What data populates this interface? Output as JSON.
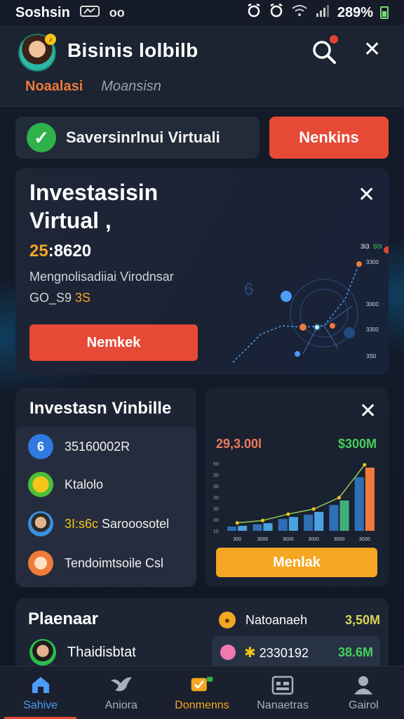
{
  "status_bar": {
    "carrier": "Soshsin",
    "extra": "oo",
    "battery_text": "289%"
  },
  "header": {
    "title": "Bisinis lolbilb",
    "tabs": [
      {
        "label": "Noaalasi",
        "active": true
      },
      {
        "label": "Moansisn",
        "active": false
      }
    ]
  },
  "notice": {
    "text": "Saversinrlnui Virtuali",
    "button_label": "Nenkins"
  },
  "card_virtual": {
    "title": "Investasisin Virtual ,",
    "amount_highlight": "25",
    "amount_rest": ":8620",
    "description": "Mengnolisadiiai Virodnsar",
    "sub_prefix": "GO_S9",
    "sub_highlight": "3S",
    "button_label": "Nemkek",
    "viz_labels": {
      "top_a": "3I3",
      "top_b": "50I",
      "ticks": [
        "3300",
        "3000",
        "3300",
        "3S0"
      ]
    }
  },
  "card_list": {
    "title": "Investasn Vinbille",
    "items": [
      {
        "icon": "6",
        "label": "35160002R",
        "highlight": ""
      },
      {
        "icon": "",
        "label": "Ktalolo",
        "highlight": ""
      },
      {
        "icon": "",
        "label": "Sarooosotel",
        "highlight": "3I:s6c"
      },
      {
        "icon": "",
        "label": "Tendoimtsoile Csl",
        "highlight": ""
      }
    ]
  },
  "card_chart": {
    "value_left": "29,3.00l",
    "value_right": "$300M",
    "button_label": "Menlak"
  },
  "chart_data": {
    "type": "bar",
    "categories": [
      "300",
      "3000",
      "3000",
      "3000",
      "3000",
      "3000"
    ],
    "values": [
      8,
      12,
      22,
      30,
      48,
      100
    ],
    "y_tick_labels": [
      "50",
      "30",
      "30",
      "30",
      "30",
      "30",
      "10"
    ],
    "title": "",
    "xlabel": "",
    "ylabel": ""
  },
  "card_plan": {
    "title": "Plaenaar",
    "row_label": "Thaidisbtat",
    "right_row1_label": "Natoanaeh",
    "right_row1_value": "3,50M",
    "right_row2_label": "2330192",
    "right_row2_value": "38.6M"
  },
  "bottom_nav": [
    {
      "label": "Sahive",
      "icon": "home-icon"
    },
    {
      "label": "Aniora",
      "icon": "bird-icon"
    },
    {
      "label": "Donmenns",
      "icon": "check-badge-icon"
    },
    {
      "label": "Nanaetras",
      "icon": "calendar-icon"
    },
    {
      "label": "Gairol",
      "icon": "profile-icon"
    }
  ],
  "colors": {
    "accent_red": "#e64a36",
    "accent_orange": "#f5a623",
    "accent_blue": "#4c9df5",
    "accent_green": "#45d05a",
    "bg": "#121826"
  }
}
